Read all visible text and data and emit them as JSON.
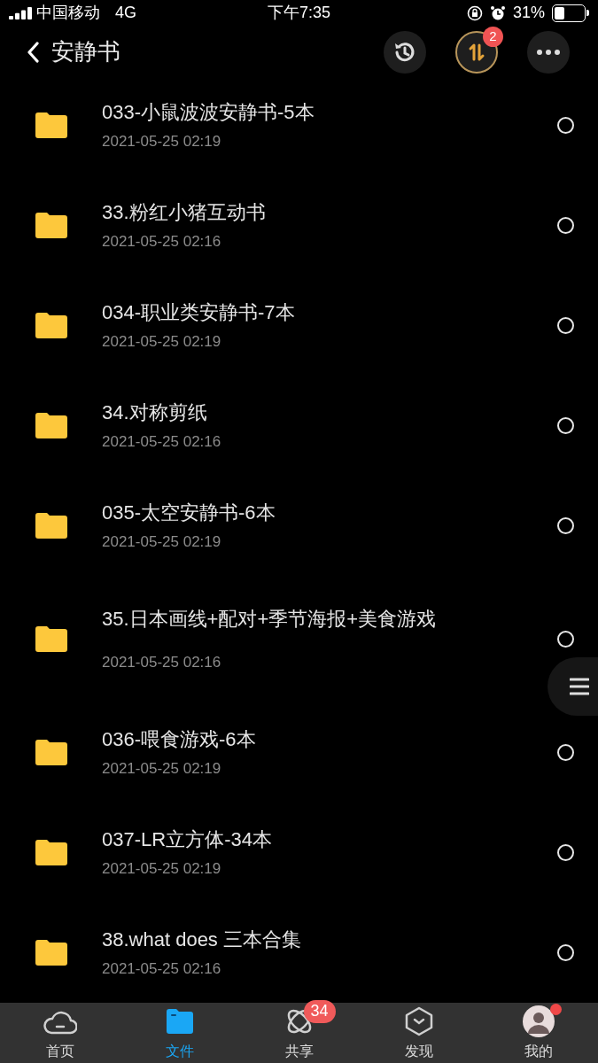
{
  "status_bar": {
    "carrier": "中国移动",
    "network": "4G",
    "time": "下午7:35",
    "battery": "31%"
  },
  "header": {
    "title": "安静书",
    "transfer_badge": "2"
  },
  "files": [
    {
      "name": "033-小鼠波波安静书-5本",
      "date": "2021-05-25 02:19",
      "checked": false
    },
    {
      "name": "33.粉红小猪互动书",
      "date": "2021-05-25 02:16",
      "checked": false
    },
    {
      "name": "034-职业类安静书-7本",
      "date": "2021-05-25 02:19",
      "checked": false
    },
    {
      "name": "34.对称剪纸",
      "date": "2021-05-25 02:16",
      "checked": false
    },
    {
      "name": "035-太空安静书-6本",
      "date": "2021-05-25 02:19",
      "checked": false
    },
    {
      "name": "35.日本画线+配对+季节海报+美食游戏",
      "date": "2021-05-25 02:16",
      "checked": false,
      "tall": true
    },
    {
      "name": "036-喂食游戏-6本",
      "date": "2021-05-25 02:19",
      "checked": false
    },
    {
      "name": "037-LR立方体-34本",
      "date": "2021-05-25 02:19",
      "checked": false
    },
    {
      "name": "38.what does 三本合集",
      "date": "2021-05-25 02:16",
      "checked": false
    }
  ],
  "tab_bar": [
    {
      "kind": "cloud",
      "label": "首页",
      "selected": false
    },
    {
      "kind": "folder",
      "label": "文件",
      "selected": true
    },
    {
      "kind": "orbit",
      "label": "共享",
      "selected": false,
      "badge": "34"
    },
    {
      "kind": "hexagon",
      "label": "发现",
      "selected": false
    },
    {
      "kind": "avatar",
      "label": "我的",
      "selected": false,
      "dot": true
    }
  ]
}
